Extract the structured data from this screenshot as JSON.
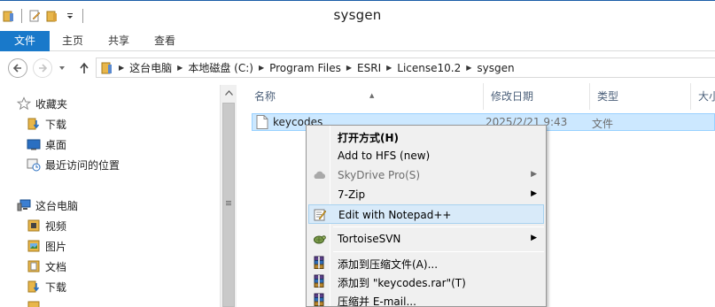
{
  "window": {
    "title": "sysgen"
  },
  "ribbon": {
    "tabs": [
      "文件",
      "主页",
      "共享",
      "查看"
    ]
  },
  "address": {
    "crumbs": [
      "这台电脑",
      "本地磁盘 (C:)",
      "Program Files",
      "ESRI",
      "License10.2",
      "sysgen"
    ]
  },
  "nav": {
    "favorites": {
      "label": "收藏夹",
      "items": [
        "下载",
        "桌面",
        "最近访问的位置"
      ]
    },
    "computer": {
      "label": "这台电脑",
      "items": [
        "视频",
        "图片",
        "文档",
        "下载"
      ]
    }
  },
  "filelist": {
    "columns": [
      "名称",
      "修改日期",
      "类型",
      "大小"
    ],
    "rows": [
      {
        "name": "keycodes",
        "modified": "2025/2/21 9:43",
        "type": "文件"
      }
    ]
  },
  "context_menu": {
    "items": [
      {
        "label": "打开方式(H)",
        "bold": true
      },
      {
        "label": "Add to HFS (new)"
      },
      {
        "label": "SkyDrive Pro(S)",
        "disabled": true,
        "submenu": true,
        "icon": "cloud-icon"
      },
      {
        "label": "7-Zip",
        "submenu": true
      },
      {
        "label": "Edit with Notepad++",
        "icon": "notepad-plus-plus-icon",
        "highlighted": true
      },
      {
        "label": "TortoiseSVN",
        "submenu": true,
        "icon": "tortoise-svn-icon"
      },
      {
        "label": "添加到压缩文件(A)...",
        "icon": "winrar-icon"
      },
      {
        "label": "添加到 \"keycodes.rar\"(T)",
        "icon": "winrar-icon"
      },
      {
        "label": "压缩并 E-mail...",
        "icon": "winrar-icon"
      }
    ]
  },
  "colors": {
    "accent": "#1979ca",
    "selection": "#cce8ff",
    "menu_bg": "#f0f0f0",
    "menu_hover": "#d8eaf9"
  }
}
